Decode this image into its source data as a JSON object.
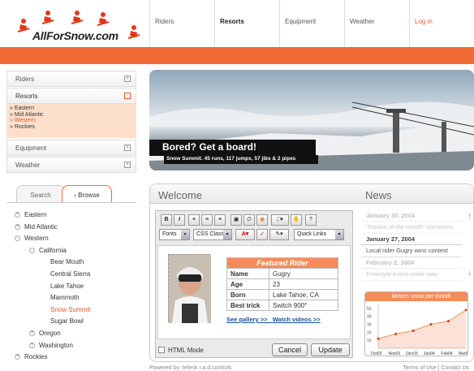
{
  "brand": {
    "name": "AllForSnow.com"
  },
  "topnav": [
    "Riders",
    "Resorts",
    "Equipment",
    "Weather",
    "Log in"
  ],
  "sidebar": {
    "items": [
      "Riders",
      "Resorts",
      "Equipment",
      "Weather"
    ],
    "resorts_sub": [
      "Eastern",
      "Mid Atlantic",
      "Western",
      "Rockies"
    ]
  },
  "tabs": {
    "search": "Search",
    "browse": "Browse"
  },
  "tree": [
    {
      "label": "Eastern",
      "level": 0,
      "toggle": "+"
    },
    {
      "label": "Mid Atlantic",
      "level": 0,
      "toggle": "+"
    },
    {
      "label": "Western",
      "level": 0,
      "toggle": "-"
    },
    {
      "label": "California",
      "level": 1,
      "toggle": "-"
    },
    {
      "label": "Bear Mouth",
      "level": 2
    },
    {
      "label": "Central Sierra",
      "level": 2
    },
    {
      "label": "Lake Tahoe",
      "level": 2
    },
    {
      "label": "Mammoth",
      "level": 2
    },
    {
      "label": "Snow Summit",
      "level": 2,
      "selected": true
    },
    {
      "label": "Sugar Bowl",
      "level": 2
    },
    {
      "label": "Oregon",
      "level": 1,
      "toggle": "+"
    },
    {
      "label": "Washington",
      "level": 1,
      "toggle": "+"
    },
    {
      "label": "Rockies",
      "level": 0,
      "toggle": "+"
    }
  ],
  "banner": {
    "title": "Bored? Get a board!",
    "subtitle": "Snow Summit. 45 runs, 117 jumps, 57 jibs & 2 pipes"
  },
  "welcome": {
    "title": "Welcome"
  },
  "editor": {
    "fonts": "Fonts",
    "css_class": "CSS Class",
    "quick_links": "Quick Links",
    "featured": {
      "header": "Featured Rider",
      "rows": [
        [
          "Name",
          "Gugry"
        ],
        [
          "Age",
          "23"
        ],
        [
          "Born",
          "Lake Tahoe, CA"
        ],
        [
          "Best trick",
          "Switch 900°"
        ]
      ]
    },
    "links": [
      "See gallery >>",
      "Watch videos >>"
    ],
    "html_mode": "HTML Mode",
    "cancel": "Cancel",
    "update": "Update"
  },
  "news": {
    "title": "News",
    "items": [
      {
        "date": "January 30, 2004",
        "text": "\"Rookie of the month\" nominees",
        "faded": true
      },
      {
        "date": "January 27, 2004",
        "text": "Local rider Gugry wins contest",
        "faded": false
      },
      {
        "date": "February 2, 2004",
        "text": "Freestyle event under way",
        "faded": true
      }
    ]
  },
  "chart_data": {
    "type": "area",
    "title": "Meters snow per month",
    "categories": [
      "Oct03",
      "Nov03",
      "Dec03",
      "Jan04",
      "Feb04",
      "Mar04"
    ],
    "values": [
      12,
      18,
      22,
      30,
      34,
      48
    ],
    "yticks": [
      "50",
      "40",
      "30",
      "20",
      "10"
    ],
    "ylim": [
      0,
      55
    ],
    "color": "#f48c5a"
  },
  "footer": {
    "left": "Powered by: telerik r.a.d.controls",
    "right": "Terms of Use  |  Contact Us"
  },
  "colors": {
    "accent": "#f26a33",
    "link": "#1b4f9a"
  }
}
